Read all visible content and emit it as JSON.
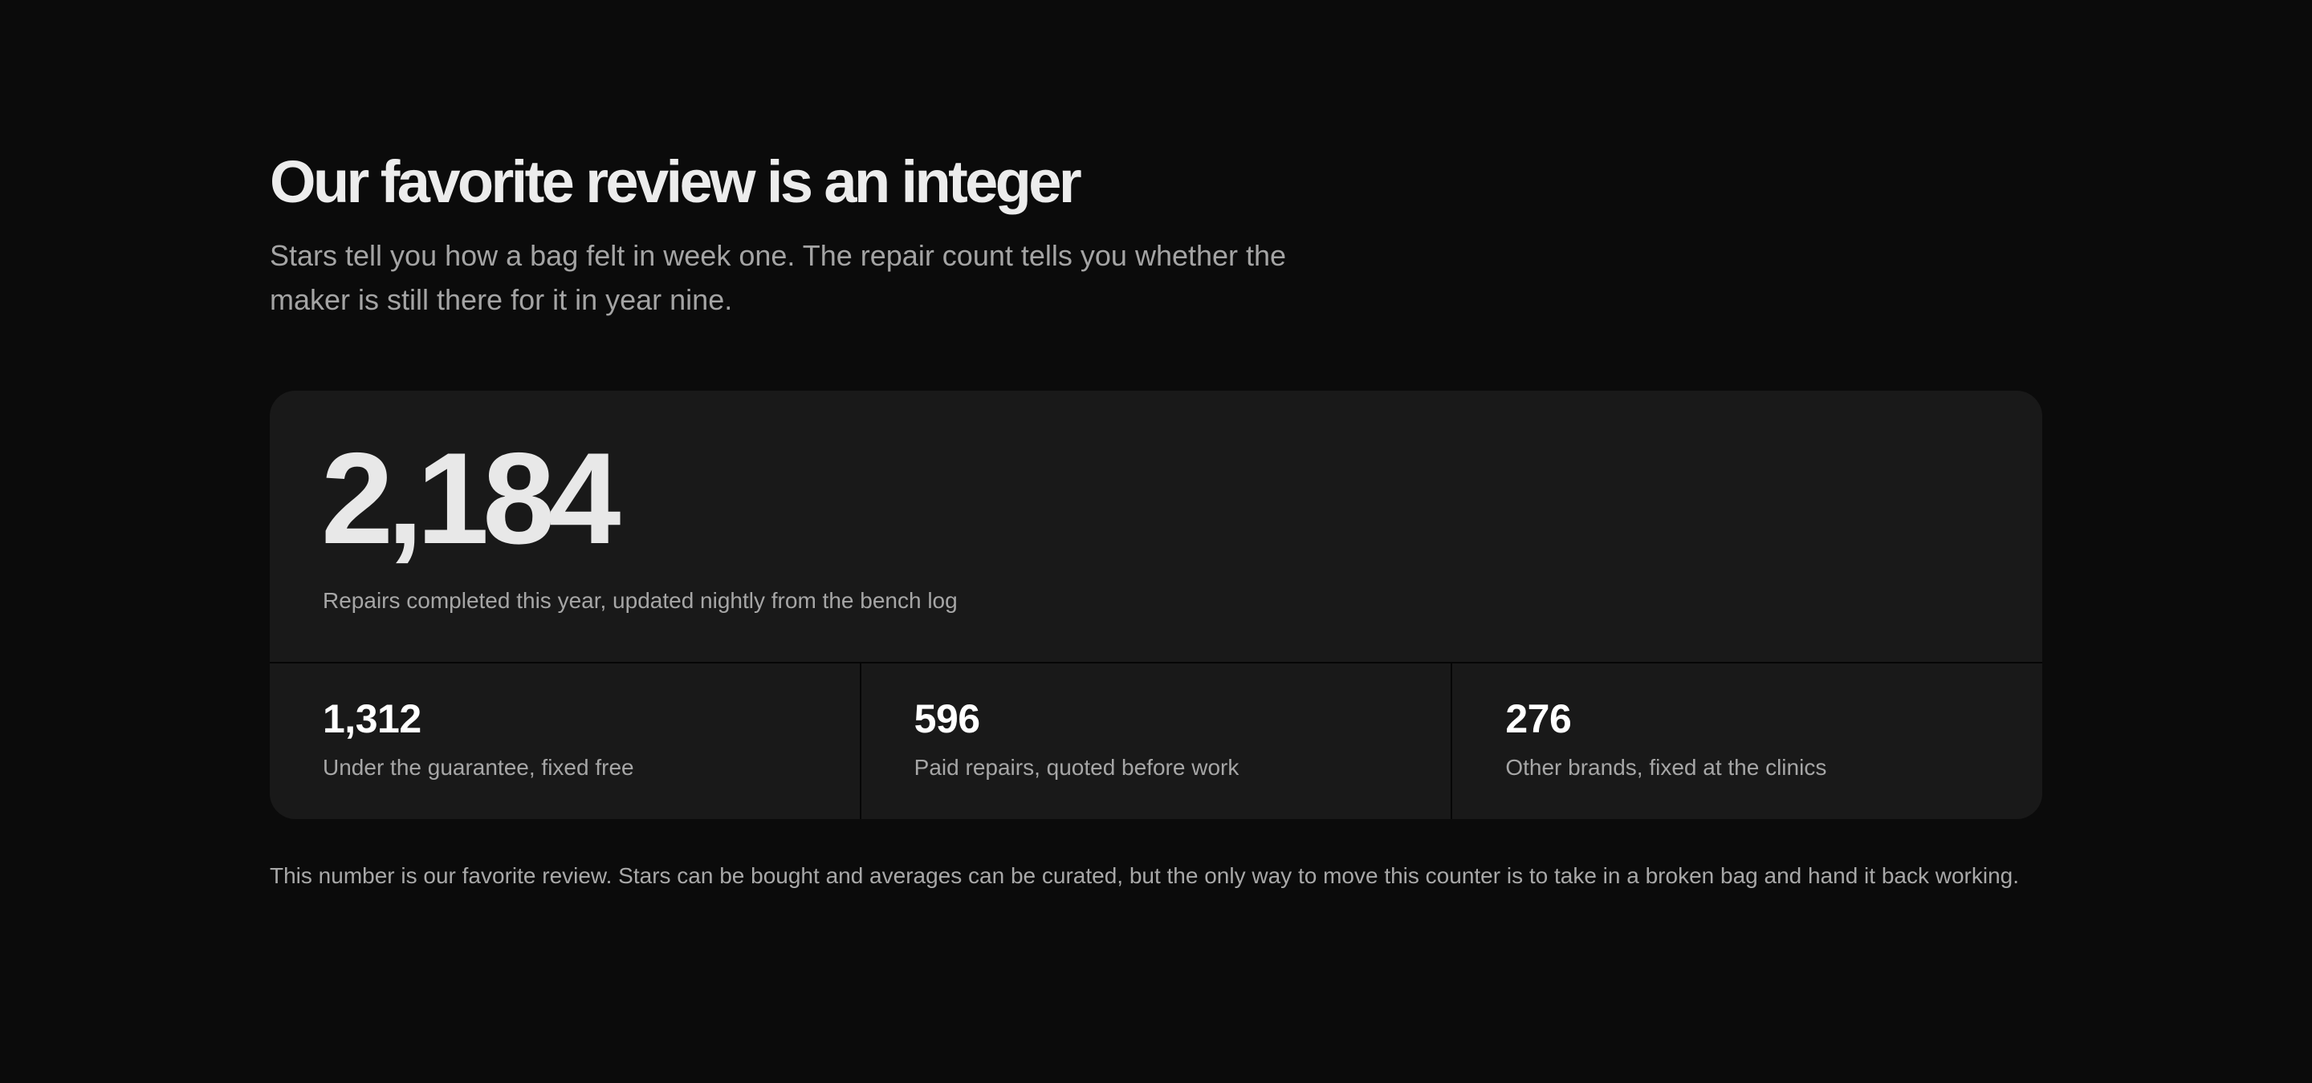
{
  "section": {
    "heading": "Our favorite review is an integer",
    "lede": "Stars tell you how a bag felt in week one. The repair count tells you whether the maker is still there for it in year nine."
  },
  "counter": {
    "total": "2,184",
    "total_caption": "Repairs completed this year, updated nightly from the bench log",
    "breakdown": [
      {
        "value": "1,312",
        "label": "Under the guarantee, fixed free"
      },
      {
        "value": "596",
        "label": "Paid repairs, quoted before work"
      },
      {
        "value": "276",
        "label": "Other brands, fixed at the clinics"
      }
    ]
  },
  "footnote": "This number is our favorite review. Stars can be bought and averages can be curated, but the only way to move this counter is to take in a broken bag and hand it back working."
}
